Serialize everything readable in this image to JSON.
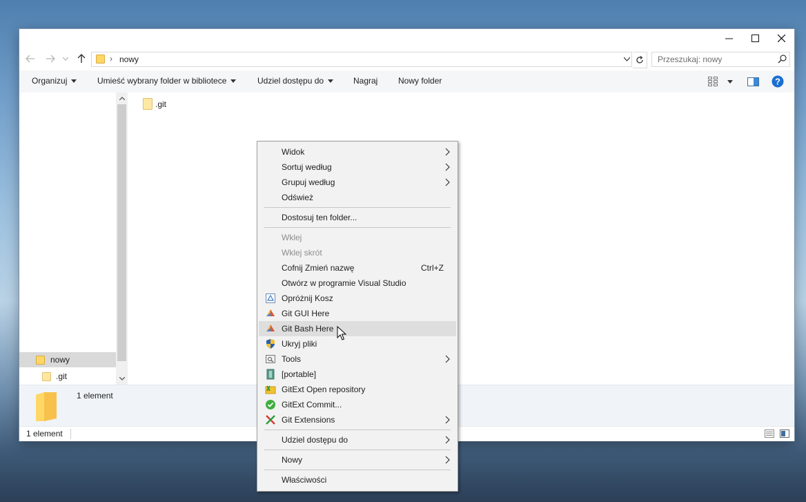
{
  "window": {
    "controls": {
      "minimize": "minimize",
      "maximize": "maximize",
      "close": "close"
    }
  },
  "address": {
    "path": "nowy",
    "separator": "›",
    "search_placeholder": "Przeszukaj: nowy"
  },
  "toolbar": {
    "organize": "Organizuj",
    "include_in_library": "Umieść wybrany folder w bibliotece",
    "share_with": "Udziel dostępu do",
    "burn": "Nagraj",
    "new_folder": "Nowy folder"
  },
  "nav_pane": {
    "items": [
      {
        "label": "nowy",
        "selected": true
      },
      {
        "label": ".git",
        "selected": false
      }
    ]
  },
  "content": {
    "items": [
      {
        "name": ".git",
        "type": "folder"
      }
    ]
  },
  "details": {
    "count": "1 element"
  },
  "status": {
    "count": "1 element"
  },
  "context_menu": {
    "items": [
      {
        "label": "Widok",
        "submenu": true
      },
      {
        "label": "Sortuj według",
        "submenu": true
      },
      {
        "label": "Grupuj według",
        "submenu": true
      },
      {
        "label": "Odśwież"
      },
      {
        "label": "Dostosuj ten folder..."
      },
      {
        "label": "Wklej",
        "disabled": true
      },
      {
        "label": "Wklej skrót",
        "disabled": true
      },
      {
        "label": "Cofnij Zmień nazwę",
        "shortcut": "Ctrl+Z"
      },
      {
        "label": "Otwórz w programie Visual Studio"
      },
      {
        "label": "Opróżnij Kosz",
        "icon": "recycle-bin-icon"
      },
      {
        "label": "Git GUI Here",
        "icon": "git-gui-icon"
      },
      {
        "label": "Git Bash Here",
        "icon": "git-bash-icon",
        "hovered": true
      },
      {
        "label": "Ukryj pliki",
        "icon": "shield-icon"
      },
      {
        "label": "Tools",
        "icon": "tools-icon",
        "submenu": true
      },
      {
        "label": "[portable]",
        "icon": "portable-icon"
      },
      {
        "label": "GitExt Open repository",
        "icon": "gitext-open-icon"
      },
      {
        "label": "GitExt Commit...",
        "icon": "gitext-commit-icon"
      },
      {
        "label": "Git Extensions",
        "icon": "git-extensions-icon",
        "submenu": true
      },
      {
        "label": "Udziel dostępu do",
        "submenu": true
      },
      {
        "label": "Nowy",
        "submenu": true
      },
      {
        "label": "Właściwości"
      }
    ]
  },
  "colors": {
    "accent": "#0078d7",
    "folder": "#ffd767",
    "menu_bg": "#f2f2f2",
    "menu_hover": "#dedede"
  }
}
